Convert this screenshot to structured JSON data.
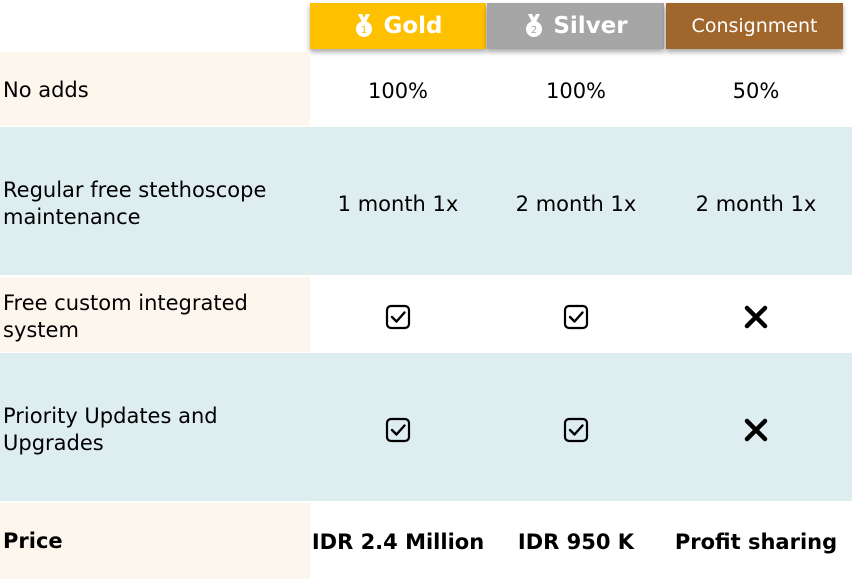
{
  "tiers": [
    {
      "name": "Gold",
      "medal_number": "1",
      "color": "#ffc000"
    },
    {
      "name": "Silver",
      "medal_number": "2",
      "color": "#a6a6a6"
    },
    {
      "name": "Consignment",
      "color": "#a0662b"
    }
  ],
  "rows": [
    {
      "label": "No adds",
      "values": [
        "100%",
        "100%",
        "50%"
      ]
    },
    {
      "label": "Regular free stethoscope maintenance",
      "values": [
        "1 month 1x",
        "2 month 1x",
        "2 month 1x"
      ]
    },
    {
      "label": "Free custom integrated system",
      "values": [
        "check-icon",
        "check-icon",
        "cross-icon"
      ]
    },
    {
      "label": "Priority Updates and Upgrades",
      "values": [
        "check-icon",
        "check-icon",
        "cross-icon"
      ]
    },
    {
      "label": "Price",
      "values": [
        "IDR 2.4 Million",
        "IDR 950 K",
        "Profit sharing"
      ]
    }
  ],
  "colors": {
    "label_cell_light": "#fdf6ec",
    "row_shaded": "#deedf0",
    "gold": "#ffc000",
    "silver": "#a6a6a6",
    "consignment": "#a0662b"
  }
}
